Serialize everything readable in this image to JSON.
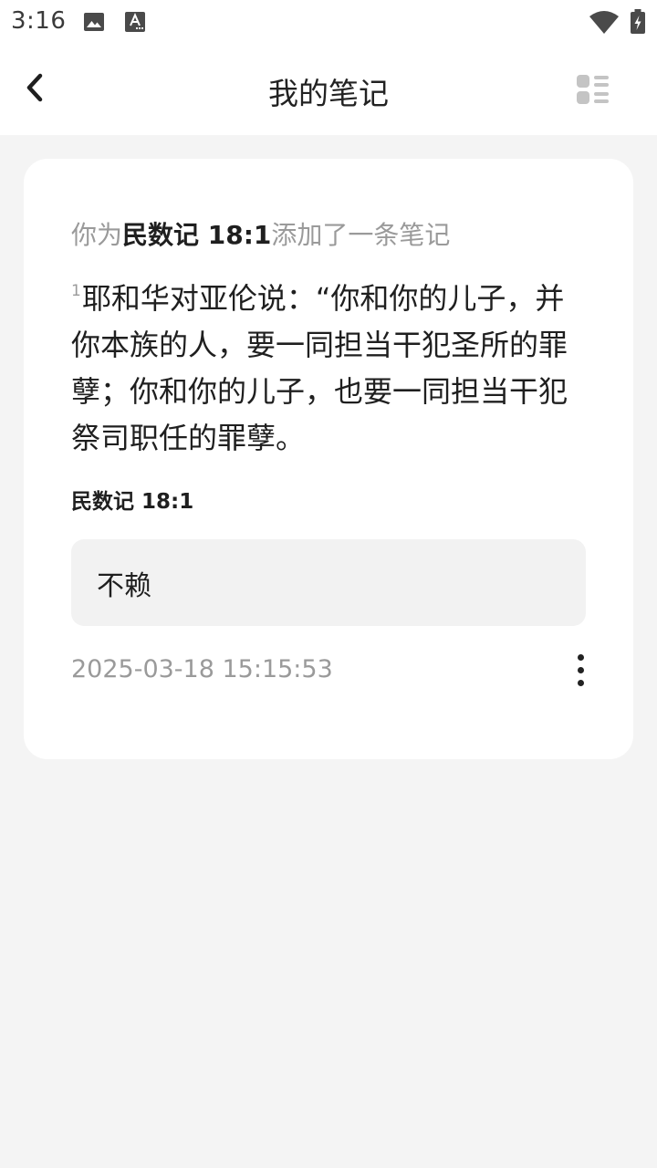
{
  "status_bar": {
    "time": "3:16",
    "left_icons": [
      "image-icon",
      "font-icon"
    ],
    "right_icons": [
      "wifi-icon",
      "battery-charging-icon"
    ]
  },
  "app_bar": {
    "title": "我的笔记",
    "back_icon": "chevron-left-icon",
    "layout_icon": "list-view-icon"
  },
  "note": {
    "header_prefix": "你为",
    "header_ref": "民数记 18:1",
    "header_suffix": "添加了一条笔记",
    "verse_number": "1",
    "verse_text": "耶和华对亚伦说：“你和你的儿子，并你本族的人，要一同担当干犯圣所的罪孽；你和你的儿子，也要一同担当干犯祭司职任的罪孽。",
    "verse_ref": "民数记 18:1",
    "body": "不赖",
    "date": "2025-03-18 15:15:53",
    "more_icon": "more-vertical-icon"
  },
  "colors": {
    "background": "#f4f4f4",
    "card": "#ffffff",
    "note_box": "#f2f2f2",
    "muted_text": "#9a9a9a",
    "text": "#1f1f1f"
  }
}
